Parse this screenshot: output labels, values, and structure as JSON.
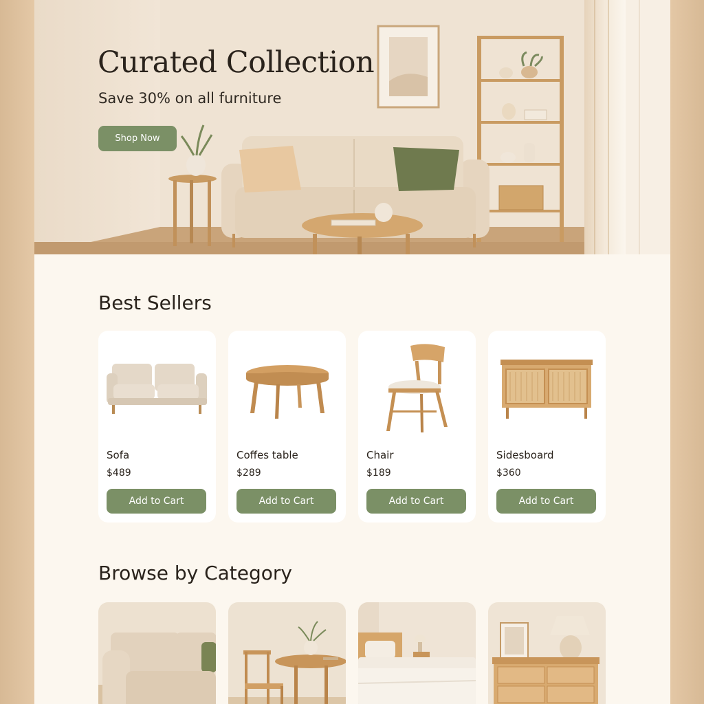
{
  "hero": {
    "title": "Curated Collection",
    "subtitle": "Save 30% on all furniture",
    "cta_label": "Shop Now"
  },
  "best_sellers": {
    "title": "Best Sellers",
    "products": [
      {
        "name": "Sofa",
        "price": "$489",
        "button": "Add to Cart",
        "image": "sofa-image"
      },
      {
        "name": "Coffes table",
        "price": "$289",
        "button": "Add to Cart",
        "image": "coffee-table-image"
      },
      {
        "name": "Chair",
        "price": "$189",
        "button": "Add to Cart",
        "image": "chair-image"
      },
      {
        "name": "Sidesboard",
        "price": "$360",
        "button": "Add to Cart",
        "image": "sideboard-image"
      }
    ]
  },
  "categories": {
    "title": "Browse by Category",
    "items": [
      {
        "image": "living-room-category-image"
      },
      {
        "image": "dining-category-image"
      },
      {
        "image": "bedroom-category-image"
      },
      {
        "image": "storage-category-image"
      }
    ]
  },
  "colors": {
    "accent": "#7b9066",
    "page_bg": "#fcf7ef",
    "frame_bg": "#e4c8a6",
    "card_bg": "#ffffff",
    "text": "#2a231c"
  }
}
